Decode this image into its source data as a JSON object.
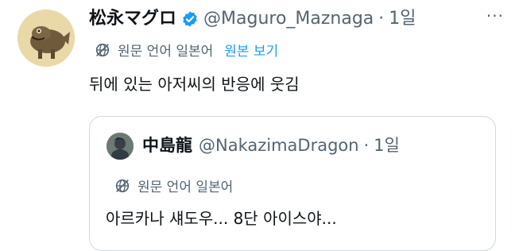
{
  "tweet": {
    "author_name": "松永マグロ",
    "author_handle": "@Maguro_Maznaga",
    "separator": "·",
    "time": "1일",
    "more_label": "···",
    "translate_label": "원문 언어 일본어",
    "show_original_label": "원본 보기",
    "text": "뒤에 있는 아저씨의 반응에 웃김"
  },
  "quote": {
    "author_name": "中島龍",
    "author_handle": "@NakazimaDragon",
    "separator": "·",
    "time": "1일",
    "translate_label": "원문 언어 일본어",
    "text": "아르카나 섀도우... 8단 아이스야..."
  },
  "colors": {
    "verified_badge": "#1d9bf0",
    "link": "#1d9bf0",
    "secondary_text": "#536471",
    "border": "#cfd9de"
  },
  "icons": {
    "verified": "verified-badge-icon",
    "translate": "globe-slash-icon",
    "more": "more-horizontal-icon"
  }
}
